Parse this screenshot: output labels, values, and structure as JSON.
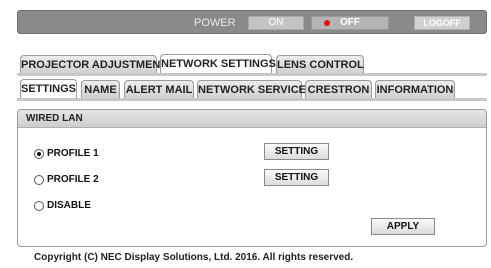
{
  "power_bar": {
    "power_label": "POWER",
    "on_label": "ON",
    "off_label": "OFF",
    "logoff_label": "LOGOFF"
  },
  "main_tabs": [
    {
      "label": "PROJECTOR ADJUSTMENT"
    },
    {
      "label": "NETWORK SETTINGS"
    },
    {
      "label": "LENS CONTROL"
    }
  ],
  "sub_tabs": [
    {
      "label": "SETTINGS"
    },
    {
      "label": "NAME"
    },
    {
      "label": "ALERT MAIL"
    },
    {
      "label": "NETWORK SERVICE"
    },
    {
      "label": "CRESTRON"
    },
    {
      "label": "INFORMATION"
    }
  ],
  "panel": {
    "title": "WIRED LAN",
    "options": [
      {
        "label": "PROFILE 1",
        "checked": true
      },
      {
        "label": "PROFILE 2",
        "checked": false
      },
      {
        "label": "DISABLE",
        "checked": false
      }
    ],
    "setting_button_label": "SETTING",
    "apply_button_label": "APPLY"
  },
  "footer": {
    "copyright": "Copyright (C) NEC Display Solutions, Ltd. 2016. All rights reserved."
  }
}
